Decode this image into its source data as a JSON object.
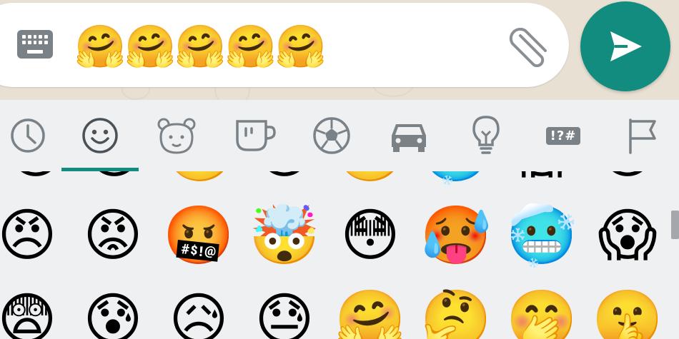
{
  "composer": {
    "message_text": "🤗🤗🤗🤗🤗",
    "keyboard_toggle": "keyboard-icon",
    "attach": "paperclip-icon",
    "send": "send-icon"
  },
  "colors": {
    "accent": "#128c7e",
    "icon_grey": "#7a8288",
    "panel_bg": "#eef0f2"
  },
  "emoji_tabs": [
    {
      "name": "recent",
      "icon": "clock-icon",
      "selected": false
    },
    {
      "name": "smileys",
      "icon": "smiley-icon",
      "selected": true
    },
    {
      "name": "animals",
      "icon": "bear-icon",
      "selected": false
    },
    {
      "name": "food",
      "icon": "cup-icon",
      "selected": false
    },
    {
      "name": "activities",
      "icon": "soccer-ball-icon",
      "selected": false
    },
    {
      "name": "travel",
      "icon": "car-icon",
      "selected": false
    },
    {
      "name": "objects",
      "icon": "lightbulb-icon",
      "selected": false
    },
    {
      "name": "symbols",
      "icon": "symbols-icon",
      "selected": false,
      "label": "!?#"
    },
    {
      "name": "flags",
      "icon": "flag-icon",
      "selected": false
    }
  ],
  "emoji_grid": {
    "partial_row": [
      "😐",
      "😶",
      "🙄",
      "😏",
      "😬",
      "🥶",
      "😱",
      "😨"
    ],
    "row_1": [
      "😠",
      "😡",
      "🤬",
      "🤯",
      "😳",
      "🥵",
      "🥶",
      "😱"
    ],
    "row_2": [
      "😨",
      "😰",
      "😥",
      "😓",
      "🤗",
      "🤔",
      "🤭",
      "🤫"
    ]
  }
}
